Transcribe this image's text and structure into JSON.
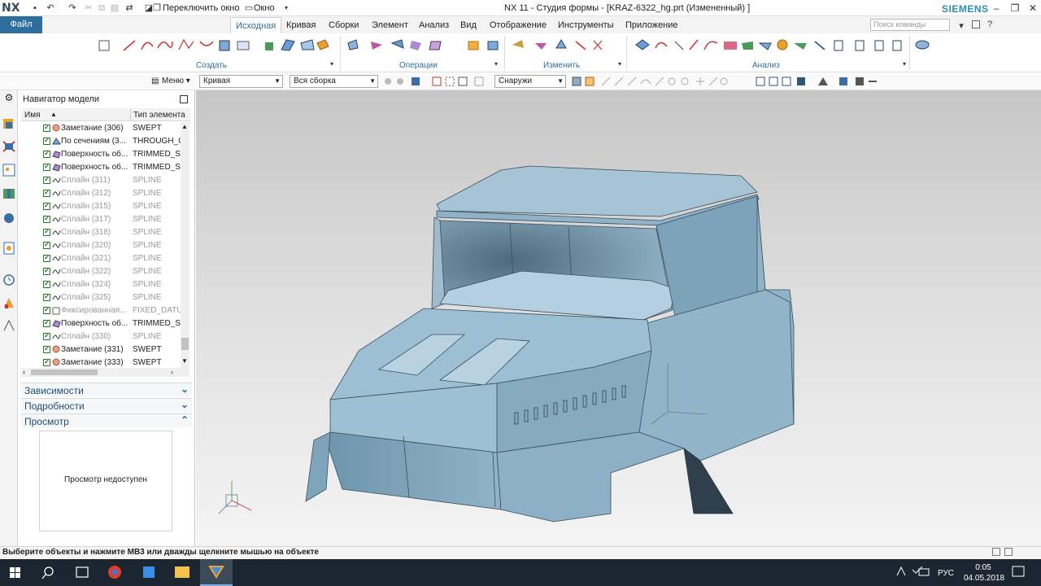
{
  "titlebar": {
    "logo": "NX",
    "switch_window": "Переключить окно",
    "window_menu": "Окно",
    "title": "NX 11 - Студия формы - [KRAZ-6322_hg.prt (Измененный) ]",
    "brand": "SIEMENS"
  },
  "ribbon": {
    "file": "Файл",
    "tabs": [
      "Исходная",
      "Кривая",
      "Сборки",
      "Элемент",
      "Анализ",
      "Вид",
      "Отображение",
      "Инструменты",
      "Приложение"
    ],
    "active_tab": "Исходная",
    "search_placeholder": "Поиск команды",
    "groups": [
      "Создать",
      "Операции",
      "Изменить",
      "Анализ"
    ]
  },
  "selection_bar": {
    "menu": "Меню",
    "filter": "Кривая",
    "scope": "Вся сборка",
    "direction": "Снаружи"
  },
  "navigator": {
    "title": "Навигатор модели",
    "col_name": "Имя",
    "col_type": "Тип элемента",
    "rows": [
      {
        "name": "Заметание (306)",
        "type": "SWEPT",
        "dim": false,
        "icon": "swept-icon"
      },
      {
        "name": "По сечениям (3...",
        "type": "THROUGH_C",
        "dim": false,
        "icon": "through-curves-icon"
      },
      {
        "name": "Поверхность об...",
        "type": "TRIMMED_SH",
        "dim": false,
        "icon": "trimmed-sheet-icon"
      },
      {
        "name": "Поверхность об...",
        "type": "TRIMMED_SH",
        "dim": false,
        "icon": "trimmed-sheet-icon"
      },
      {
        "name": "Сплайн (311)",
        "type": "SPLINE",
        "dim": true,
        "icon": "spline-icon"
      },
      {
        "name": "Сплайн (312)",
        "type": "SPLINE",
        "dim": true,
        "icon": "spline-icon"
      },
      {
        "name": "Сплайн (315)",
        "type": "SPLINE",
        "dim": true,
        "icon": "spline-icon"
      },
      {
        "name": "Сплайн (317)",
        "type": "SPLINE",
        "dim": true,
        "icon": "spline-icon"
      },
      {
        "name": "Сплайн (318)",
        "type": "SPLINE",
        "dim": true,
        "icon": "spline-icon"
      },
      {
        "name": "Сплайн (320)",
        "type": "SPLINE",
        "dim": true,
        "icon": "spline-icon"
      },
      {
        "name": "Сплайн (321)",
        "type": "SPLINE",
        "dim": true,
        "icon": "spline-icon"
      },
      {
        "name": "Сплайн (322)",
        "type": "SPLINE",
        "dim": true,
        "icon": "spline-icon"
      },
      {
        "name": "Сплайн (324)",
        "type": "SPLINE",
        "dim": true,
        "icon": "spline-icon"
      },
      {
        "name": "Сплайн (325)",
        "type": "SPLINE",
        "dim": true,
        "icon": "spline-icon"
      },
      {
        "name": "Фиксированная...",
        "type": "FIXED_DATUI",
        "dim": true,
        "icon": "datum-plane-icon"
      },
      {
        "name": "Поверхность об...",
        "type": "TRIMMED_SH",
        "dim": false,
        "icon": "trimmed-sheet-icon"
      },
      {
        "name": "Сплайн (330)",
        "type": "SPLINE",
        "dim": true,
        "icon": "spline-icon"
      },
      {
        "name": "Заметание (331)",
        "type": "SWEPT",
        "dim": false,
        "icon": "swept-icon"
      },
      {
        "name": "Заметание (333)",
        "type": "SWEPT",
        "dim": false,
        "icon": "swept-icon"
      }
    ],
    "sections": [
      "Зависимости",
      "Подробности",
      "Просмотр"
    ],
    "preview_text": "Просмотр недоступен"
  },
  "status": "Выберите объекты и нажмите MB3 или дважды щелкните мышью на объекте",
  "taskbar": {
    "lang": "РУС",
    "time": "0:05",
    "date": "04.05.2018"
  },
  "colors": {
    "accent": "#2e6f9e",
    "model": "#8fb3c8",
    "brand": "#2a8fb0"
  }
}
